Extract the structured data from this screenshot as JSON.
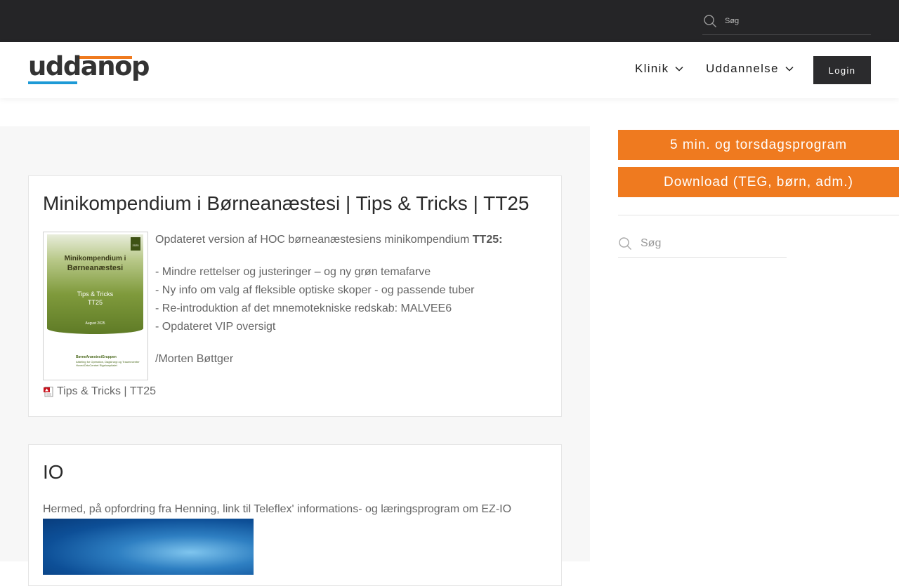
{
  "topbar": {
    "search": {
      "placeholder": "Søg",
      "icon": "search-icon"
    }
  },
  "header": {
    "logo_text": "uddanop",
    "nav": [
      {
        "label": "Klinik",
        "icon": "chevron-down-icon"
      },
      {
        "label": "Uddannelse",
        "icon": "chevron-down-icon"
      }
    ],
    "login_label": "Login"
  },
  "colors": {
    "topbar": "#252527",
    "accent_orange": "#ef7a1f",
    "accent_blue": "#1d9ad6",
    "login_bg": "#2b2b2d"
  },
  "posts": [
    {
      "title": "Minikompendium i Børneanæstesi | Tips & Tricks | TT25",
      "cover": {
        "line1": "Minikompendium i",
        "line2": "Børneanæstesi",
        "line3": "Tips & Tricks",
        "line4": "TT25",
        "date": "August 2025",
        "badge": "2025",
        "org": "BørneAnæstesiGruppen",
        "sub": "Afdeling for Operation, Dagkirurgi og Traumecenter HovedOrtoCentret Rigshospitalet"
      },
      "intro_text": "Opdateret version af HOC børneanæstesiens minikompendium ",
      "intro_bold": "TT25:",
      "bullets": [
        "- Mindre rettelser og justeringer – og ny grøn temafarve",
        "- Ny info om valg af fleksible optiske skoper - og passende tuber",
        "- Re-introduktion af det mnemotekniske redskab: MALVEE6",
        "- Opdateret VIP oversigt"
      ],
      "signature": "/Morten Bøttger",
      "attachment_label": "Tips & Tricks | TT25",
      "attachment_icon": "pdf-icon"
    },
    {
      "title": "IO",
      "text": "Hermed, på opfordring fra Henning, link til Teleflex' informations- og læringsprogram om EZ-IO"
    }
  ],
  "sidebar": {
    "buttons": [
      {
        "label": "5 min. og torsdagsprogram"
      },
      {
        "label": "Download (TEG, børn, adm.)"
      }
    ],
    "search": {
      "placeholder": "Søg",
      "icon": "search-icon"
    }
  }
}
